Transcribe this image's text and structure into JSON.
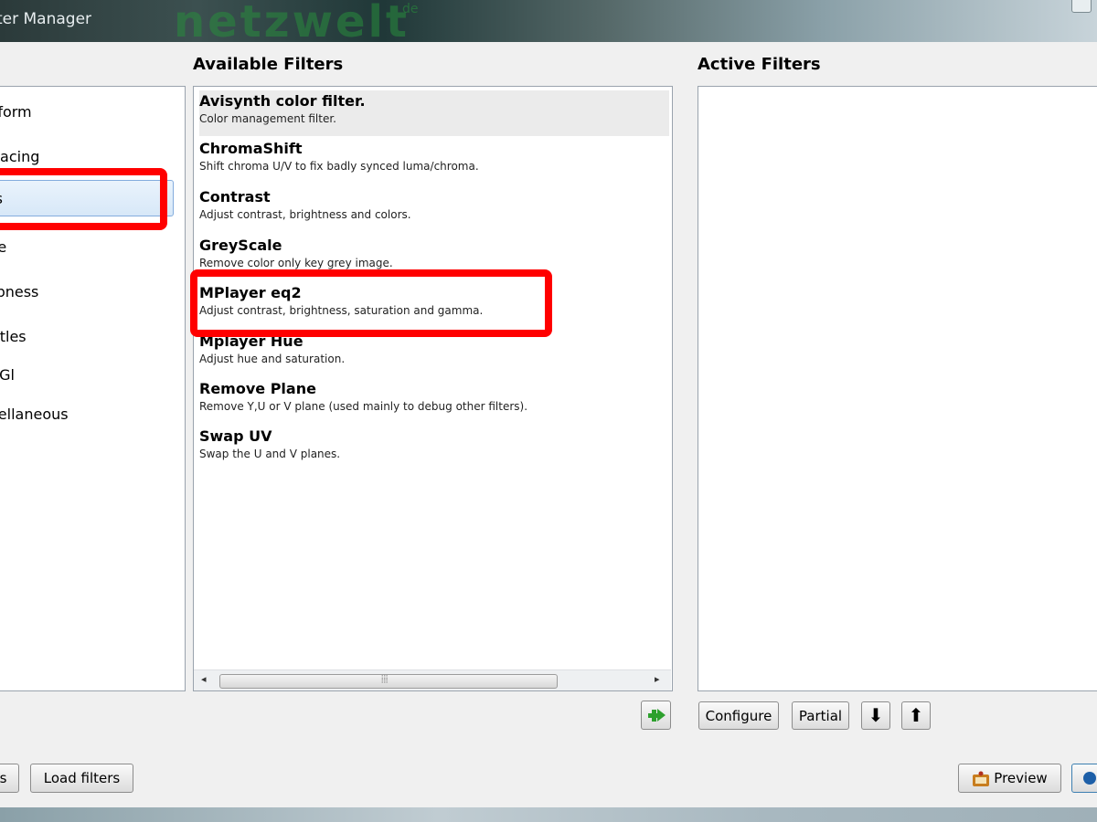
{
  "window": {
    "title": "ter Manager",
    "watermark": "netzwelt",
    "watermark_suffix": "de"
  },
  "categories": {
    "items": [
      {
        "label": "sform"
      },
      {
        "label": "rlacing"
      },
      {
        "label": "rs"
      },
      {
        "label": "se"
      },
      {
        "label": "rpness"
      },
      {
        "label": "titles"
      },
      {
        "label": "nGl"
      },
      {
        "label": "cellaneous"
      }
    ],
    "selected_index": 2
  },
  "available": {
    "heading": "Available Filters",
    "filters": [
      {
        "name": "Avisynth color filter.",
        "desc": "Color management filter."
      },
      {
        "name": "ChromaShift",
        "desc": "Shift chroma U/V to fix badly synced luma/chroma."
      },
      {
        "name": "Contrast",
        "desc": "Adjust contrast, brightness and colors."
      },
      {
        "name": "GreyScale",
        "desc": "Remove color only key grey image."
      },
      {
        "name": "MPlayer eq2",
        "desc": "Adjust contrast, brightness, saturation and gamma."
      },
      {
        "name": "Mplayer Hue",
        "desc": "Adjust hue and saturation."
      },
      {
        "name": "Remove Plane",
        "desc": "Remove Y,U or V plane (used mainly to debug other filters)."
      },
      {
        "name": "Swap UV",
        "desc": "Swap the U and V planes."
      }
    ],
    "selected_index": 0,
    "scroll_left_glyph": "◂",
    "scroll_right_glyph": "▸",
    "scroll_grip_glyph": "⦙⦙⦙",
    "add_icon": "green-add-arrow-icon"
  },
  "active": {
    "heading": "Active Filters",
    "configure_label": "Configure",
    "partial_label": "Partial",
    "down_icon": "arrow-down-icon",
    "up_icon": "arrow-up-icon",
    "down_glyph": "⬇",
    "up_glyph": "⬆"
  },
  "footer": {
    "left_button_label": "s",
    "load_filters_label": "Load filters",
    "preview_label": "Preview"
  },
  "colors": {
    "highlight": "#ff0000",
    "add_arrow": "#2da02d",
    "selection": "#d7e8f8"
  }
}
